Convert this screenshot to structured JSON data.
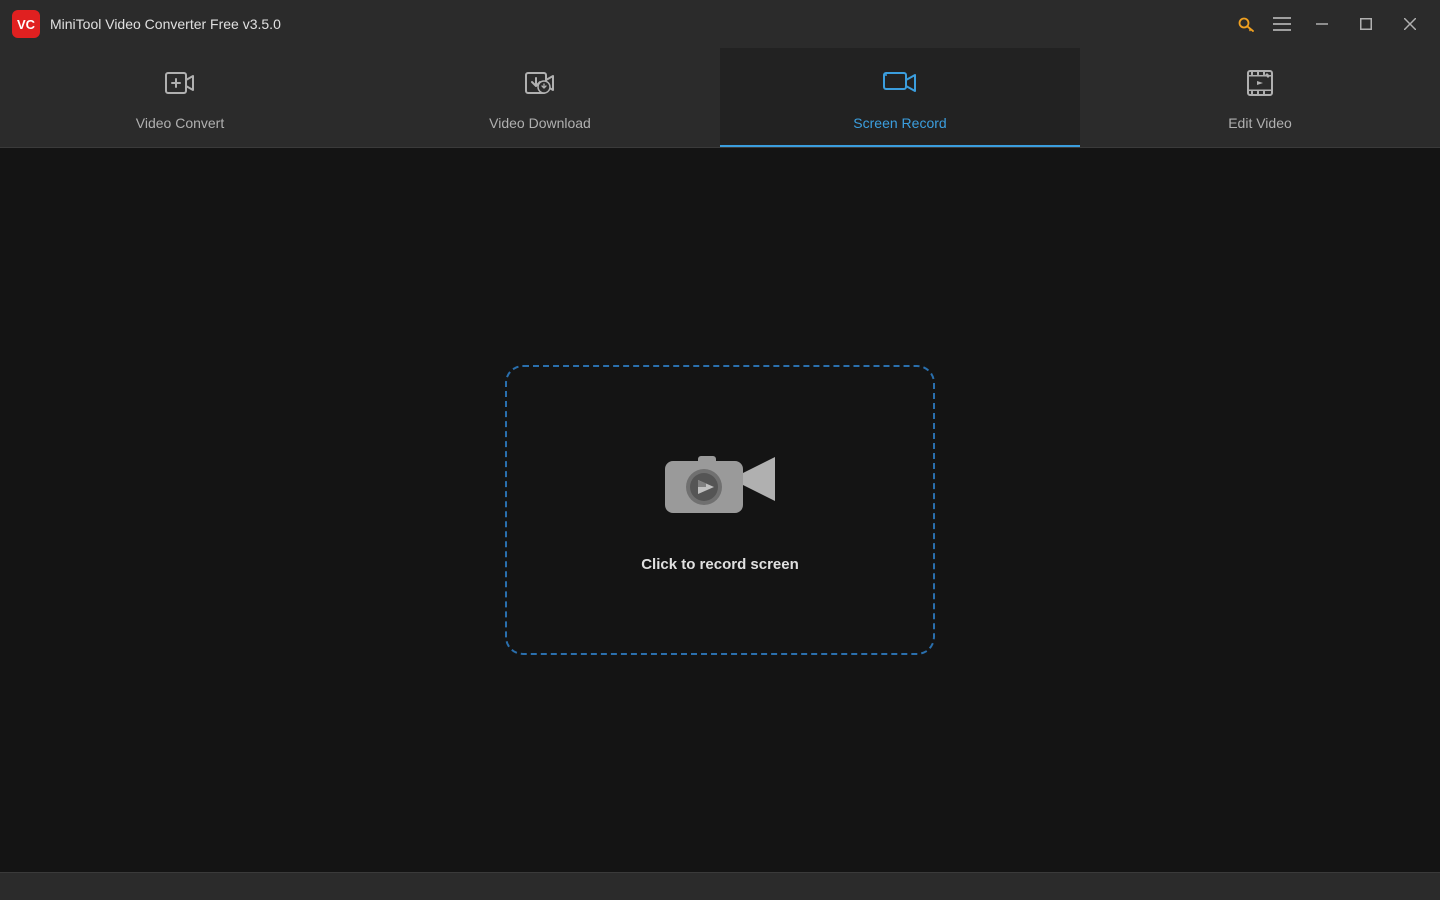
{
  "app": {
    "title": "MiniTool Video Converter Free v3.5.0",
    "logo_text": "VC"
  },
  "titlebar": {
    "key_icon": "🔑",
    "menu_icon": "☰",
    "minimize_icon": "─",
    "maximize_icon": "□",
    "close_icon": "✕"
  },
  "tabs": [
    {
      "id": "video-convert",
      "label": "Video Convert",
      "active": false
    },
    {
      "id": "video-download",
      "label": "Video Download",
      "active": false
    },
    {
      "id": "screen-record",
      "label": "Screen Record",
      "active": true
    },
    {
      "id": "edit-video",
      "label": "Edit Video",
      "active": false
    }
  ],
  "main": {
    "record_button_label": "Click to record screen"
  },
  "colors": {
    "accent": "#3b9ede",
    "title_bg": "#2b2b2b",
    "main_bg": "#141414",
    "active_tab_color": "#3b9ede",
    "inactive_tab_color": "#b0b0b0",
    "dashed_border": "#2a6fad"
  }
}
